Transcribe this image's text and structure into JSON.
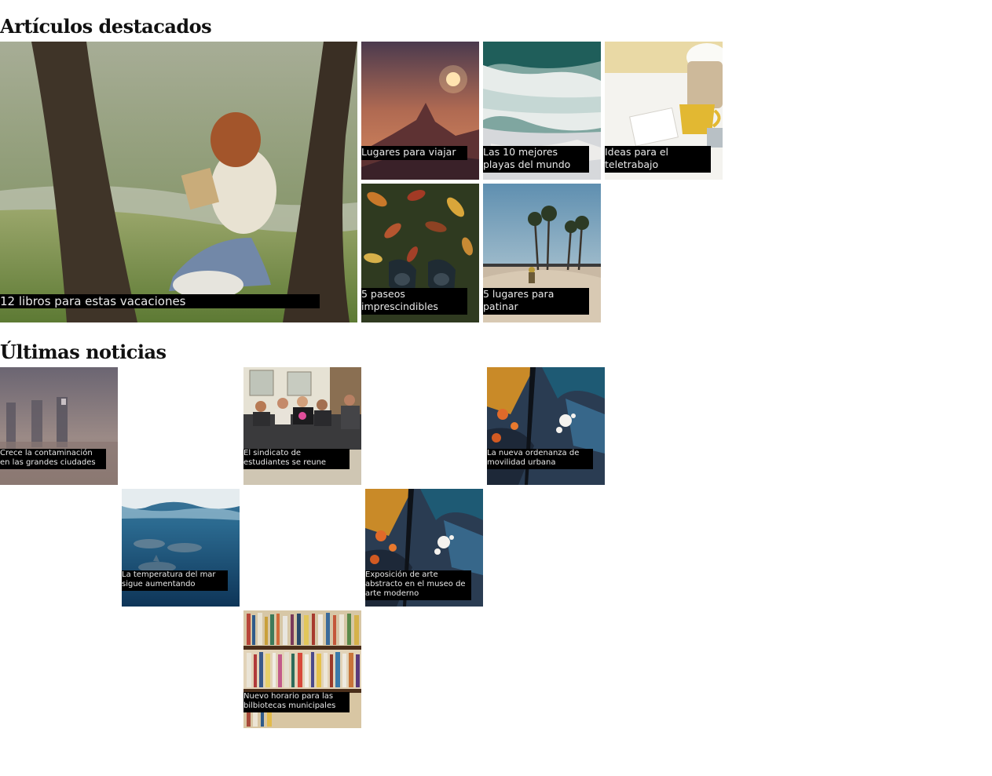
{
  "sections": {
    "featured": {
      "title": "Artículos destacados",
      "items": [
        {
          "caption": "12 libros para estas vacaciones",
          "image": "woman-reading-under-trees"
        },
        {
          "caption": "Lugares para viajar",
          "image": "mountain-sunset"
        },
        {
          "caption": "Las 10 mejores playas del mundo",
          "image": "ocean-waves-aerial"
        },
        {
          "caption": "Ideas para el teletrabajo",
          "image": "desk-with-cup"
        },
        {
          "caption": "5 paseos imprescindibles",
          "image": "shoes-on-autumn-leaves"
        },
        {
          "caption": "5 lugares para patinar",
          "image": "skatepark-palm-trees"
        }
      ]
    },
    "news": {
      "title": "Últimas noticias",
      "items": [
        {
          "caption": "Crece la contaminación en las grandes ciudades",
          "image": "smoggy-skyline"
        },
        {
          "caption": "El sindicato de estudiantes se reune",
          "image": "group-meeting"
        },
        {
          "caption": "La nueva ordenanza de movilidad urbana",
          "image": "abstract-painting"
        },
        {
          "caption": "La temperatura del mar sigue aumentando",
          "image": "dolphins-underwater"
        },
        {
          "caption": "Exposición de arte abstracto en el museo de arte moderno",
          "image": "abstract-painting"
        },
        {
          "caption": "Nuevo horario para las bilbiotecas municipales",
          "image": "bookshelves"
        }
      ]
    }
  }
}
